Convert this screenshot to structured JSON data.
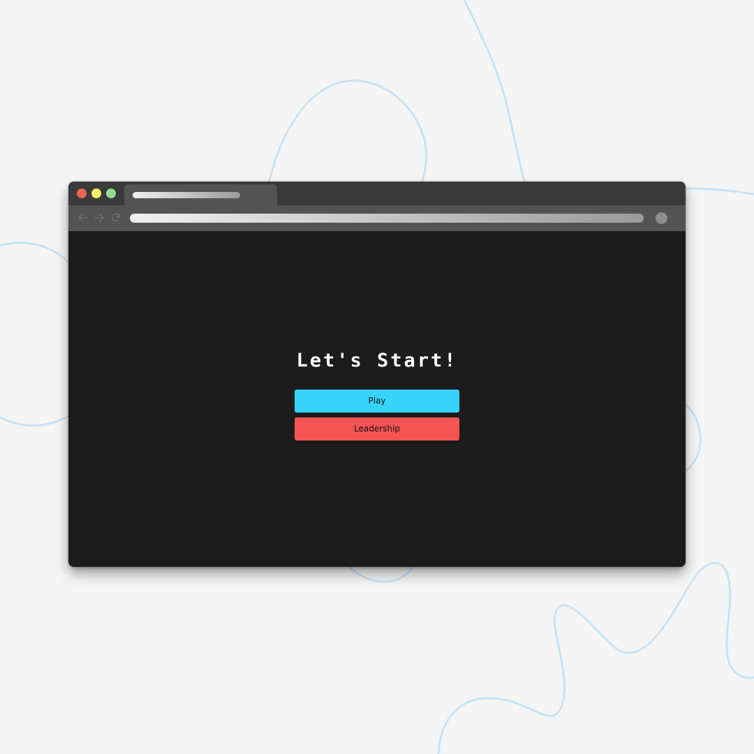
{
  "heading": "Let's Start!",
  "buttons": {
    "play_label": "Play",
    "leadership_label": "Leadership"
  },
  "colors": {
    "play": "#38d3fb",
    "leadership": "#f65353",
    "traffic_red": "#f2625a",
    "traffic_yellow": "#f7f16b",
    "traffic_green": "#96d996",
    "background_lines": "#c9e3f3"
  },
  "icons": {
    "back": "arrow-left-icon",
    "forward": "arrow-right-icon",
    "reload": "reload-icon"
  }
}
